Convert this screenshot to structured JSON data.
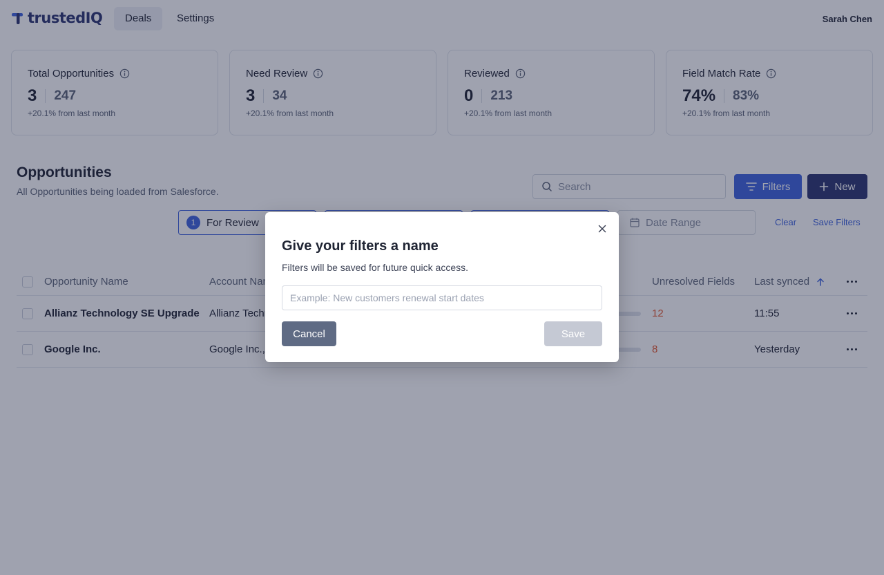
{
  "app": {
    "logo_text": "trustedIQ",
    "nav_tabs": [
      {
        "label": "Deals",
        "active": true
      },
      {
        "label": "Settings",
        "active": false
      }
    ],
    "user_name": "Sarah Chen"
  },
  "stats": [
    {
      "title": "Total Opportunities",
      "value": "3",
      "total": "247",
      "change": "+20.1% from last month"
    },
    {
      "title": "Need Review",
      "value": "3",
      "total": "34",
      "change": "+20.1% from last month"
    },
    {
      "title": "Reviewed",
      "value": "0",
      "total": "213",
      "change": "+20.1% from last month"
    },
    {
      "title": "Field Match Rate",
      "value": "74%",
      "total": "83%",
      "change": "+20.1% from last month"
    }
  ],
  "opportunities": {
    "title": "Opportunities",
    "subtitle": "All Opportunities being loaded from Salesforce.",
    "search_placeholder": "Search",
    "filters_label": "Filters",
    "new_label": "New",
    "chips": [
      {
        "badge": "1",
        "label": "For Review"
      }
    ],
    "date_range_placeholder": "Date Range",
    "clear_label": "Clear",
    "save_filters_label": "Save Filters",
    "columns": {
      "name": "Opportunity Name",
      "account": "Account Name",
      "unresolved": "Unresolved Fields",
      "last_synced": "Last synced"
    },
    "rows": [
      {
        "name": "Allianz Technology SE Upgrade",
        "account": "Allianz Technology SE",
        "unresolved": "12",
        "last_synced": "11:55"
      },
      {
        "name": "Google Inc.",
        "account": "Google Inc.,",
        "unresolved": "8",
        "last_synced": "Yesterday"
      }
    ]
  },
  "modal": {
    "title": "Give your filters a name",
    "description": "Filters will be saved for future quick access.",
    "input_placeholder": "Example: New customers renewal start dates",
    "input_value": "",
    "cancel_label": "Cancel",
    "save_label": "Save"
  },
  "colors": {
    "primary": "#3e63dd",
    "navy": "#2c3571",
    "warning": "#e4572e",
    "overlay": "rgba(26,33,64,0.42)"
  }
}
